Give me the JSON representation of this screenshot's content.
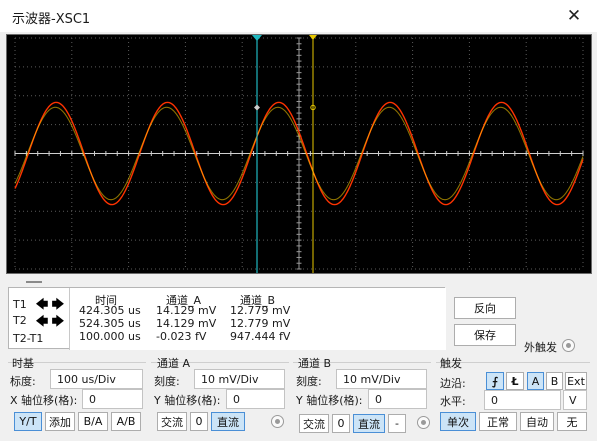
{
  "window": {
    "title": "示波器-XSC1",
    "close_glyph": "✕"
  },
  "scope": {
    "background": "#000000",
    "grid_color": "#5a5a5a",
    "trace_a_color": "#ff3300",
    "trace_b_color": "#ffd000",
    "cursor1_color": "#20b8c0",
    "cursor2_color": "#e8c800"
  },
  "cursors": {
    "t1_label": "T1",
    "t2_label": "T2",
    "dt_label": "T2-T1",
    "left_arrow": "🡄",
    "right_arrow": "🡆",
    "headers": {
      "time": "时间",
      "channel_a": "通道_A",
      "channel_b": "通道_B"
    },
    "rows": [
      {
        "time": "424.305 us",
        "a": "14.129 mV",
        "b": "12.779 mV"
      },
      {
        "time": "524.305 us",
        "a": "14.129 mV",
        "b": "12.779 mV"
      },
      {
        "time": "100.000 us",
        "a": "-0.023 fV",
        "b": "947.444 fV"
      }
    ]
  },
  "actions": {
    "reverse": "反向",
    "save": "保存",
    "ext_trigger": "外触发"
  },
  "timebase": {
    "title": "时基",
    "scale_label": "标度:",
    "scale_value": "100 us/Div",
    "xpos_label": "X 轴位移(格):",
    "xpos_value": "0",
    "modes": [
      "Y/T",
      "添加",
      "B/A",
      "A/B"
    ],
    "active_mode": "Y/T"
  },
  "channel_a": {
    "title": "通道 A",
    "scale_label": "刻度:",
    "scale_value": "10 mV/Div",
    "ypos_label": "Y 轴位移(格):",
    "ypos_value": "0",
    "coupling": [
      "交流",
      "0",
      "直流"
    ],
    "active_coupling": "直流"
  },
  "channel_b": {
    "title": "通道 B",
    "scale_label": "刻度:",
    "scale_value": "10 mV/Div",
    "ypos_label": "Y 轴位移(格):",
    "ypos_value": "0",
    "coupling": [
      "交流",
      "0",
      "直流",
      "-"
    ],
    "active_coupling": "直流"
  },
  "trigger": {
    "title": "触发",
    "edge_label": "边沿:",
    "edge_rise": "⨍",
    "edge_fall": "Ł",
    "sources": [
      "A",
      "B",
      "Ext"
    ],
    "active_source": "A",
    "level_label": "水平:",
    "level_value": "0",
    "level_unit": "V",
    "modes": [
      "单次",
      "正常",
      "自动",
      "无"
    ],
    "active_mode": "单次"
  }
}
